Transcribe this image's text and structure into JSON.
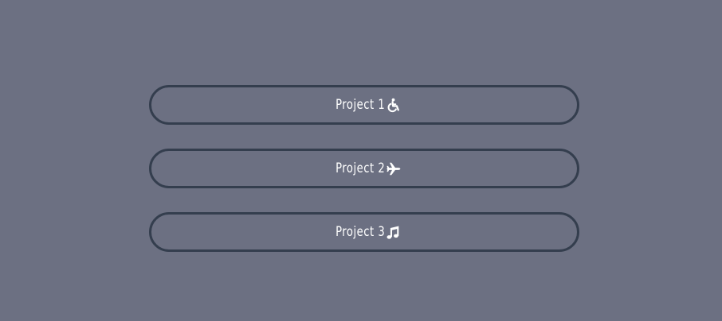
{
  "projects": [
    {
      "label": "Project 1",
      "icon": "wheelchair-icon"
    },
    {
      "label": "Project 2",
      "icon": "airplane-icon"
    },
    {
      "label": "Project 3",
      "icon": "music-note-icon"
    }
  ],
  "colors": {
    "background": "#6c7082",
    "border": "#343e4e",
    "text": "#ffffff"
  }
}
